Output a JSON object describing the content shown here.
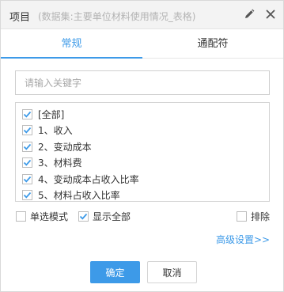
{
  "dialog": {
    "title": "项目",
    "subtitle": "(数据集:主要单位材料使用情况_表格)",
    "edit_icon": "pencil-icon",
    "close_icon": "close-icon"
  },
  "tabs": [
    {
      "label": "常规",
      "active": true
    },
    {
      "label": "通配符",
      "active": false
    }
  ],
  "search": {
    "placeholder": "请输入关键字",
    "value": ""
  },
  "items": [
    {
      "label": "[全部]",
      "checked": true
    },
    {
      "label": "1、收入",
      "checked": true
    },
    {
      "label": "2、变动成本",
      "checked": true
    },
    {
      "label": "3、材料费",
      "checked": true
    },
    {
      "label": "4、变动成本占收入比率",
      "checked": true
    },
    {
      "label": "5、材料占收入比率",
      "checked": true
    }
  ],
  "options": {
    "single_mode": {
      "label": "单选模式",
      "checked": false
    },
    "show_all": {
      "label": "显示全部",
      "checked": true
    },
    "exclude": {
      "label": "排除",
      "checked": false
    }
  },
  "advanced_link": "高级设置>>",
  "buttons": {
    "ok": "确定",
    "cancel": "取消"
  },
  "colors": {
    "accent": "#3d9ae8",
    "border": "#d4d4d4",
    "title_bg": "#f3f3f3"
  }
}
